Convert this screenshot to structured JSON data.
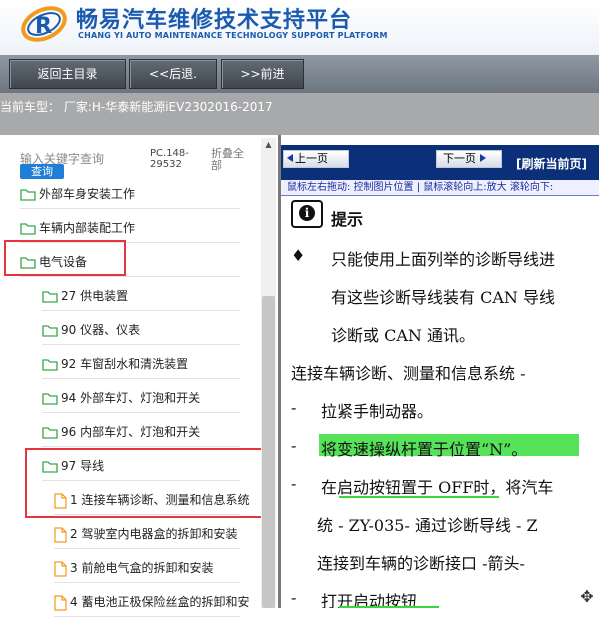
{
  "header": {
    "title_cn": "畅易汽车维修技术支持平台",
    "title_en": "CHANG YI AUTO MAINTENANCE TECHNOLOGY SUPPORT PLATFORM",
    "logo_letter": "R"
  },
  "toolbar": {
    "home_label": "返回主目录",
    "back_label": "<<后退.",
    "forward_label": ">>前进"
  },
  "model_bar": {
    "text": "当前车型：  厂家:H-华泰新能源iEV2302016-2017"
  },
  "left_panel": {
    "search_placeholder": "输入关键字查询",
    "search_button": "查询",
    "pc_code": "PC.148-29532",
    "collapse_label": "折叠全部",
    "tree": [
      {
        "label": "外部车身安装工作",
        "type": "folder"
      },
      {
        "label": "车辆内部装配工作",
        "type": "folder"
      },
      {
        "label": "电气设备",
        "type": "folder"
      },
      {
        "label": "27 供电装置",
        "type": "folder"
      },
      {
        "label": "90 仪器、仪表",
        "type": "folder"
      },
      {
        "label": "92 车窗刮水和清洗装置",
        "type": "folder"
      },
      {
        "label": "94 外部车灯、灯泡和开关",
        "type": "folder"
      },
      {
        "label": "96 内部车灯、灯泡和开关",
        "type": "folder"
      },
      {
        "label": "97 导线",
        "type": "folder"
      },
      {
        "label": "1 连接车辆诊断、测量和信息系统",
        "type": "doc"
      },
      {
        "label": "2 驾驶室内电器盒的拆卸和安装",
        "type": "doc"
      },
      {
        "label": "3 前舱电气盒的拆卸和安装",
        "type": "doc"
      },
      {
        "label": "4 蓄电池正极保险丝盒的拆卸和安",
        "type": "doc"
      }
    ]
  },
  "right_panel": {
    "prev_page": "上一页",
    "next_page": "下一页",
    "refresh": "[刷新当前页]",
    "hint": "鼠标左右拖动: 控制图片位置 | 鼠标滚轮向上:放大  滚轮向下:",
    "doc": {
      "tip_title": "提示",
      "lines": [
        "只能使用上面列举的诊断导线进",
        "有这些诊断导线装有 CAN 导线",
        "诊断或 CAN 通讯。",
        "连接车辆诊断、测量和信息系统 -",
        "拉紧手制动器。",
        "将变速操纵杆置于位置“N”。",
        "在启动按钮置于 OFF时，将汽车",
        "统  - ZY-035- 通过诊断导线 - Z",
        "连接到车辆的诊断接口 -箭头-",
        "打开启动按钮"
      ],
      "bullet": "♦",
      "dash": "-",
      "info_icon": "i"
    }
  },
  "colors": {
    "brand_blue": "#1a5bb0",
    "nav_dark": "#0c2f7a",
    "highlight_red": "#e8343f",
    "highlight_green": "#56e35a"
  }
}
